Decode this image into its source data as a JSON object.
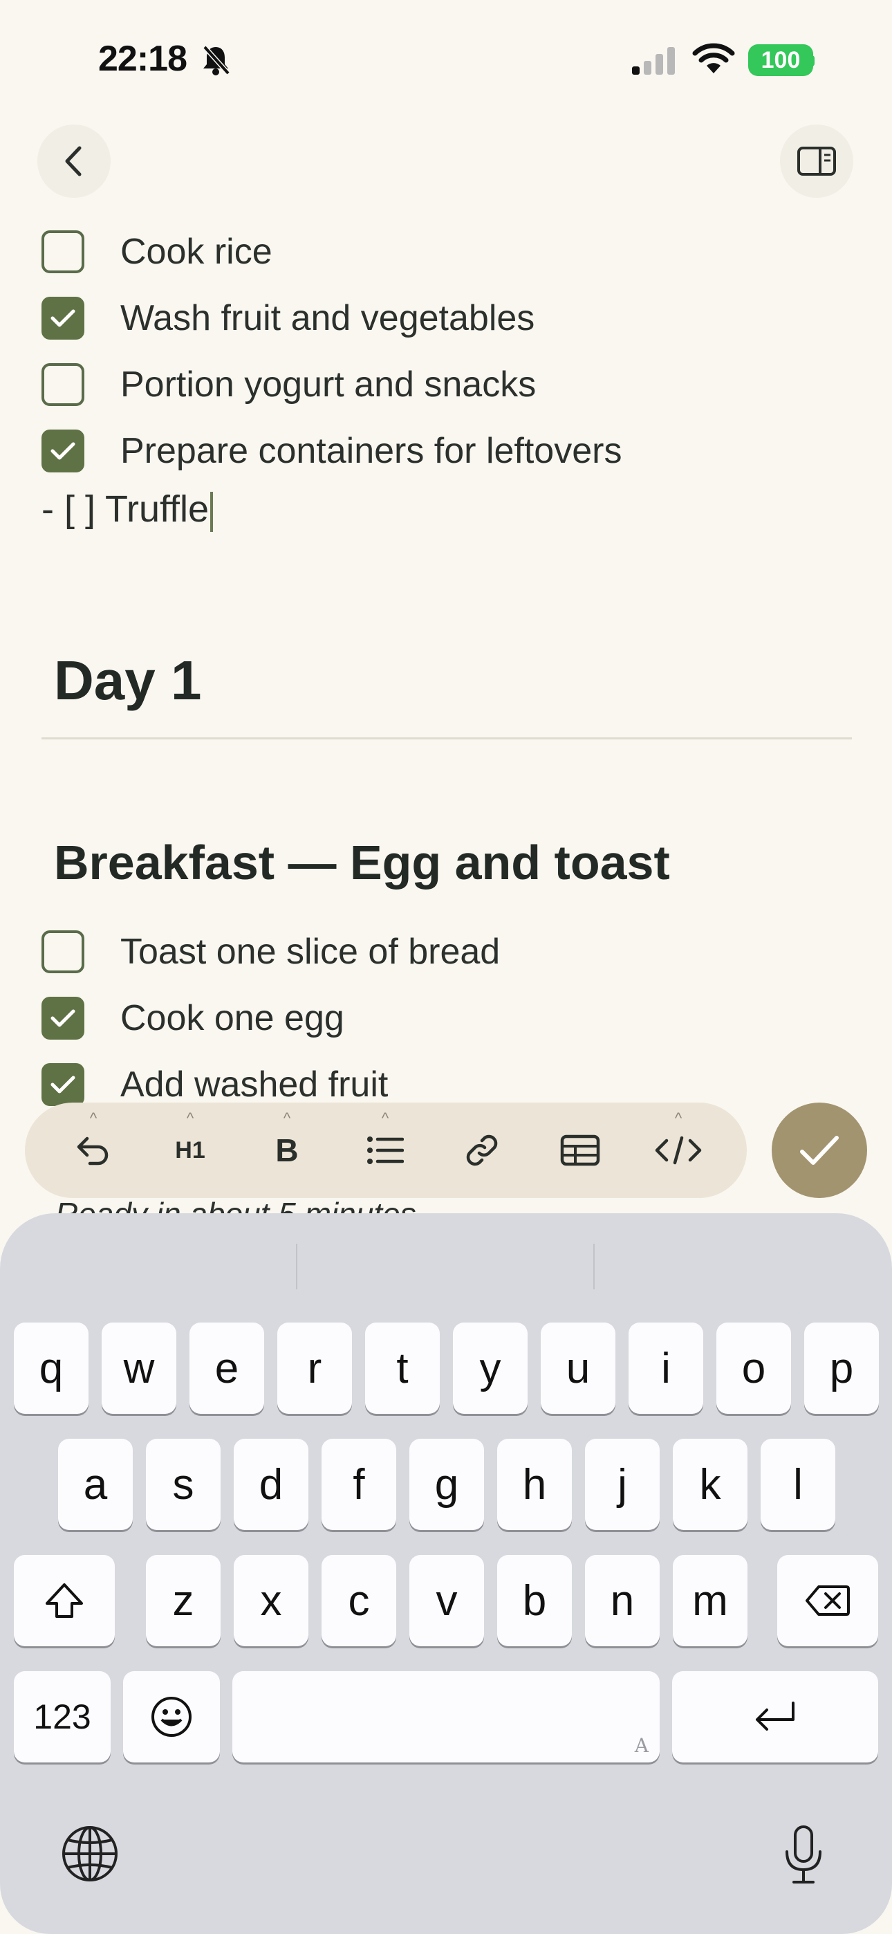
{
  "status_bar": {
    "time": "22:18",
    "battery": "100",
    "icons": [
      "bell-slash-icon",
      "cellular-signal-icon",
      "wifi-icon",
      "battery-icon"
    ]
  },
  "nav": {
    "back_icon": "chevron-left-icon",
    "panel_icon": "sidebar-panel-icon"
  },
  "note": {
    "tasks_top": [
      {
        "label": "Cook rice",
        "checked": false
      },
      {
        "label": "Wash fruit and vegetables",
        "checked": true
      },
      {
        "label": "Portion yogurt and snacks",
        "checked": false
      },
      {
        "label": "Prepare containers for leftovers",
        "checked": true
      }
    ],
    "editing_line": "- [ ] Truffle",
    "heading_day": "Day 1",
    "heading_meal": "Breakfast — Egg and toast",
    "tasks_breakfast": [
      {
        "label": "Toast one slice of bread",
        "checked": false
      },
      {
        "label": "Cook one egg",
        "checked": true
      },
      {
        "label": "Add washed fruit",
        "checked": true
      }
    ],
    "partial_text": "Ready in about 5 minutes"
  },
  "toolbar": {
    "items": [
      {
        "icon": "undo-icon"
      },
      {
        "icon": "heading-icon",
        "label": "H1"
      },
      {
        "icon": "bold-icon",
        "label": "B"
      },
      {
        "icon": "bulleted-list-icon"
      },
      {
        "icon": "link-icon"
      },
      {
        "icon": "table-icon"
      },
      {
        "icon": "code-icon"
      }
    ],
    "done_icon": "checkmark-icon",
    "accent": "#a39470"
  },
  "keyboard": {
    "row1": [
      "q",
      "w",
      "e",
      "r",
      "t",
      "y",
      "u",
      "i",
      "o",
      "p"
    ],
    "row2": [
      "a",
      "s",
      "d",
      "f",
      "g",
      "h",
      "j",
      "k",
      "l"
    ],
    "row3": [
      "z",
      "x",
      "c",
      "v",
      "b",
      "n",
      "m"
    ],
    "numbers_label": "123",
    "space_hint": "A"
  },
  "colors": {
    "background": "#f9f7f0",
    "checkbox_checked": "#5f7245",
    "battery": "#34c759",
    "keyboard": "#d7d9de"
  }
}
